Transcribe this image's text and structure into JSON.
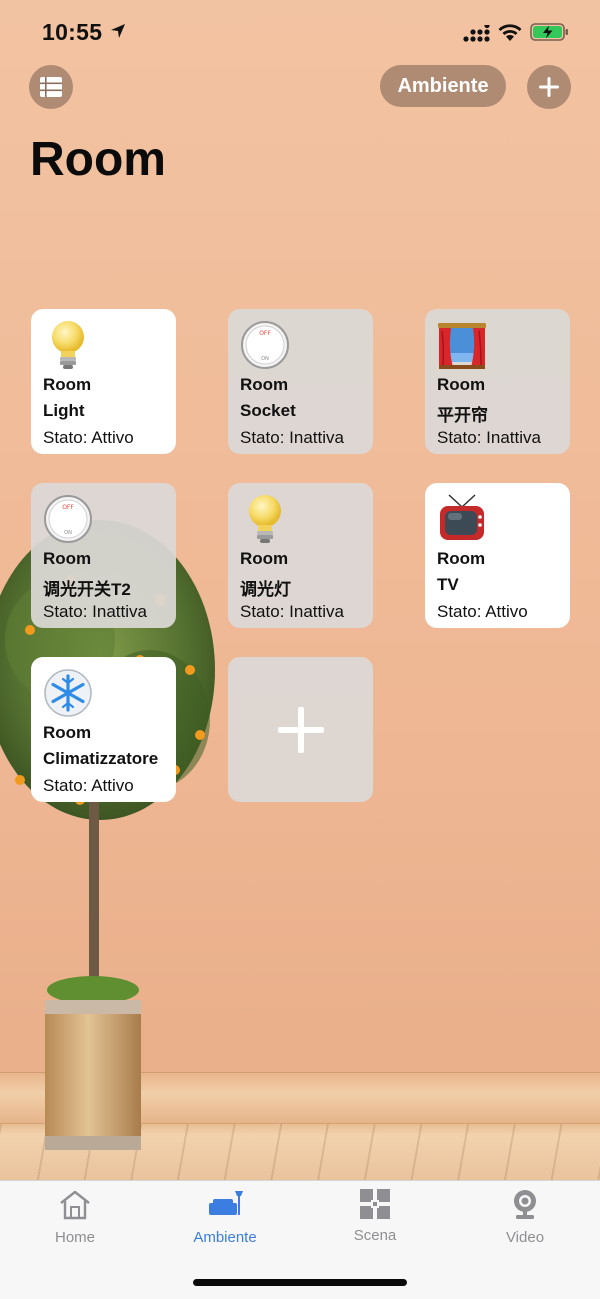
{
  "status_bar": {
    "time": "10:55",
    "icons": [
      "location-arrow-icon",
      "cellular-signal-icon",
      "wifi-icon",
      "battery-charging-icon"
    ]
  },
  "header": {
    "menu_icon": "list-icon",
    "ambiente_button": "Ambiente",
    "add_icon": "plus-icon"
  },
  "page_title": "Room",
  "devices": [
    {
      "room": "Room",
      "name": "Light",
      "status": "Stato: Attivo",
      "state": "active",
      "icon": "lightbulb-icon"
    },
    {
      "room": "Room",
      "name": "Socket",
      "status": "Stato: Inattiva",
      "state": "inactive",
      "icon": "switch-icon"
    },
    {
      "room": "Room",
      "name": "平开帘",
      "status": "Stato: Inattiva",
      "state": "inactive",
      "icon": "curtain-icon"
    },
    {
      "room": "Room",
      "name": "调光开关T2",
      "status": "Stato: Inattiva",
      "state": "inactive",
      "icon": "switch-icon"
    },
    {
      "room": "Room",
      "name": "调光灯",
      "status": "Stato: Inattiva",
      "state": "inactive",
      "icon": "lightbulb-icon"
    },
    {
      "room": "Room",
      "name": "TV",
      "status": "Stato: Attivo",
      "state": "active",
      "icon": "tv-icon"
    },
    {
      "room": "Room",
      "name": "Climatizzatore",
      "status": "Stato: Attivo",
      "state": "active",
      "icon": "snowflake-icon"
    }
  ],
  "switch_labels": {
    "off": "OFF",
    "on": "ON"
  },
  "add_device_icon": "plus-icon",
  "tabs": [
    {
      "label": "Home",
      "icon": "home-icon",
      "selected": false
    },
    {
      "label": "Ambiente",
      "icon": "sofa-icon",
      "selected": true
    },
    {
      "label": "Scena",
      "icon": "scene-grid-icon",
      "selected": false
    },
    {
      "label": "Video",
      "icon": "camera-icon",
      "selected": false
    }
  ],
  "colors": {
    "background": "#efb794",
    "accent": "#3b7de0",
    "header_button_bg": "#7a5f50",
    "card_active": "#ffffff",
    "card_inactive": "#dcd8d6",
    "battery_green": "#34c759"
  }
}
